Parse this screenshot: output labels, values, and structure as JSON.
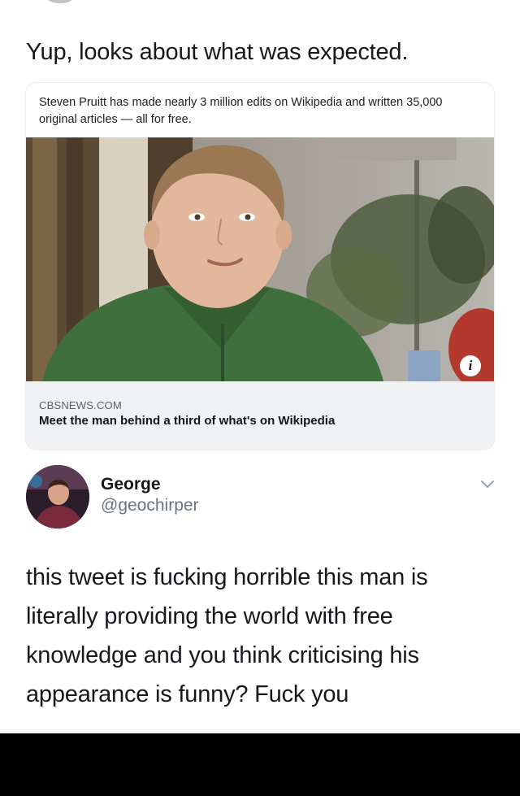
{
  "tweet": {
    "text": "Yup, looks about what was expected."
  },
  "card": {
    "caption": "Steven Pruitt has made nearly 3 million edits on Wikipedia and written 35,000 original articles — all for free.",
    "info_icon": "i",
    "domain": "CBSNEWS.COM",
    "title": "Meet the man behind a third of what's on Wikipedia"
  },
  "reply": {
    "name": "George",
    "handle": "@geochirper",
    "text": "this tweet is fucking horrible this man is literally providing the world with free knowledge and you think criticising his appearance is funny? Fuck you",
    "menu_icon": "chevron-down-icon"
  },
  "colors": {
    "handle_gray": "#657786",
    "card_footer_bg": "#f1f2f3",
    "bottom_bar": "#000000"
  }
}
